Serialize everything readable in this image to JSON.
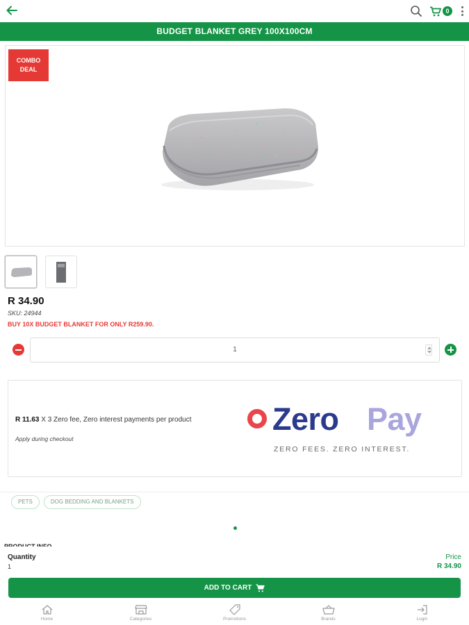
{
  "header": {
    "back_icon": "arrow-left-icon",
    "search_icon": "search-icon",
    "cart_icon": "cart-icon",
    "cart_count": "0",
    "menu_icon": "kebab-menu-icon"
  },
  "product": {
    "title": "BUDGET BLANKET GREY 100X100CM",
    "badge": "COMBO DEAL",
    "price": "R 34.90",
    "sku": "SKU: 24944",
    "promo": "BUY 10X BUDGET BLANKET FOR ONLY R259.90.",
    "quantity": "1"
  },
  "zeropay": {
    "installment_amount": "R 11.63",
    "installment_text": " X 3 Zero fee, Zero interest payments per product",
    "note": "Apply during checkout",
    "logo_zero": "Zero",
    "logo_pay": "Pay",
    "tagline": "ZERO FEES. ZERO INTEREST."
  },
  "tags": [
    "PETS",
    "DOG BEDDING AND BLANKETS"
  ],
  "section": {
    "product_info": "PRODUCT INFO"
  },
  "cart_panel": {
    "quantity_label": "Quantity",
    "quantity_value": "1",
    "price_label": "Price",
    "price_value": "R 34.90",
    "add_to_cart": "ADD TO CART"
  },
  "nav": [
    {
      "label": "Home",
      "icon": "home-icon"
    },
    {
      "label": "Categories",
      "icon": "store-icon"
    },
    {
      "label": "Promotions",
      "icon": "tag-icon"
    },
    {
      "label": "Brands",
      "icon": "basket-icon"
    },
    {
      "label": "Login",
      "icon": "login-icon"
    }
  ],
  "colors": {
    "brand_green": "#159447",
    "alert_red": "#e53935",
    "zeropay_navy": "#2b3a8c",
    "zeropay_lilac": "#a9a6dd"
  }
}
